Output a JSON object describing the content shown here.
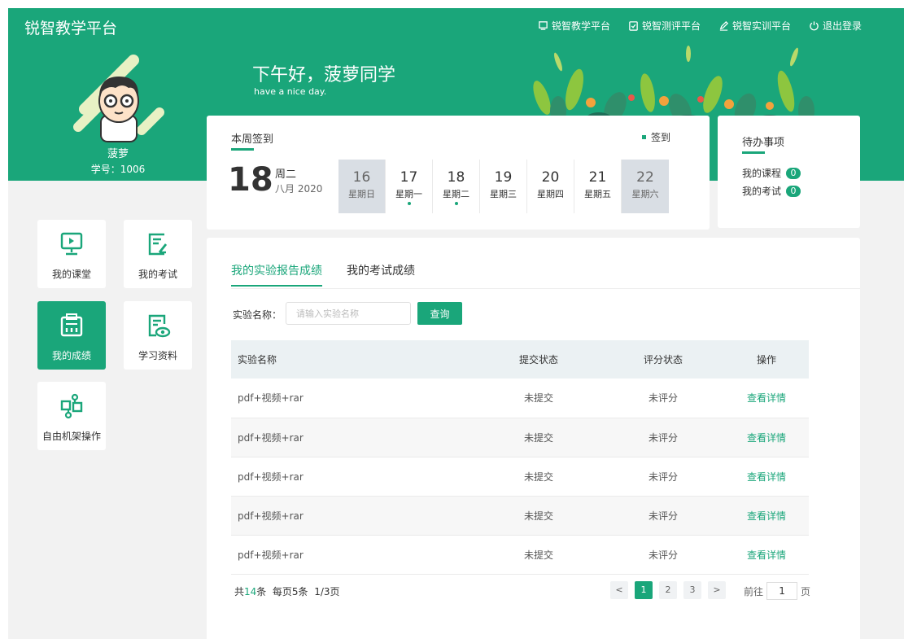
{
  "brand": "锐智教学平台",
  "nav": {
    "teach": "锐智教学平台",
    "eval": "锐智测评平台",
    "train": "锐智实训平台",
    "logout": "退出登录"
  },
  "user": {
    "name": "菠萝",
    "id_line": "学号：1006"
  },
  "greeting": {
    "title": "下午好，菠萝同学",
    "subtitle": "have a nice day."
  },
  "checkin": {
    "title": "本周签到",
    "link": "签到",
    "big_day": "18",
    "weekday": "周二",
    "month": "八月 2020",
    "days": [
      {
        "num": "16",
        "wd": "星期日",
        "signed": false
      },
      {
        "num": "17",
        "wd": "星期一",
        "signed": true
      },
      {
        "num": "18",
        "wd": "星期二",
        "signed": true
      },
      {
        "num": "19",
        "wd": "星期三",
        "signed": false
      },
      {
        "num": "20",
        "wd": "星期四",
        "signed": false
      },
      {
        "num": "21",
        "wd": "星期五",
        "signed": false
      },
      {
        "num": "22",
        "wd": "星期六",
        "signed": false
      }
    ]
  },
  "todo": {
    "title": "待办事项",
    "courses_label": "我的课程",
    "courses_count": "0",
    "exams_label": "我的考试",
    "exams_count": "0"
  },
  "tiles": {
    "classroom": "我的课堂",
    "exam": "我的考试",
    "grades": "我的成绩",
    "materials": "学习资料",
    "rack": "自由机架操作"
  },
  "results": {
    "tab_lab": "我的实验报告成绩",
    "tab_exam": "我的考试成绩",
    "search_label": "实验名称：",
    "search_placeholder": "请输入实验名称",
    "search_button": "查询",
    "headers": {
      "name": "实验名称",
      "submit": "提交状态",
      "grade": "评分状态",
      "action": "操作"
    },
    "rows": [
      {
        "name": "pdf+视频+rar",
        "submit": "未提交",
        "grade": "未评分",
        "action": "查看详情"
      },
      {
        "name": "pdf+视频+rar",
        "submit": "未提交",
        "grade": "未评分",
        "action": "查看详情"
      },
      {
        "name": "pdf+视频+rar",
        "submit": "未提交",
        "grade": "未评分",
        "action": "查看详情"
      },
      {
        "name": "pdf+视频+rar",
        "submit": "未提交",
        "grade": "未评分",
        "action": "查看详情"
      },
      {
        "name": "pdf+视频+rar",
        "submit": "未提交",
        "grade": "未评分",
        "action": "查看详情"
      }
    ],
    "summary": {
      "prefix": "共",
      "total": "14",
      "suffix": "条  每页5条  1/3页"
    },
    "pager": {
      "prev": "<",
      "pages": [
        "1",
        "2",
        "3"
      ],
      "next": ">",
      "goto_label": "前往",
      "goto_value": "1",
      "goto_unit": "页"
    }
  },
  "colors": {
    "accent": "#1aa67a",
    "background": "#f2f2f2",
    "header_row": "#ebf1f3"
  }
}
